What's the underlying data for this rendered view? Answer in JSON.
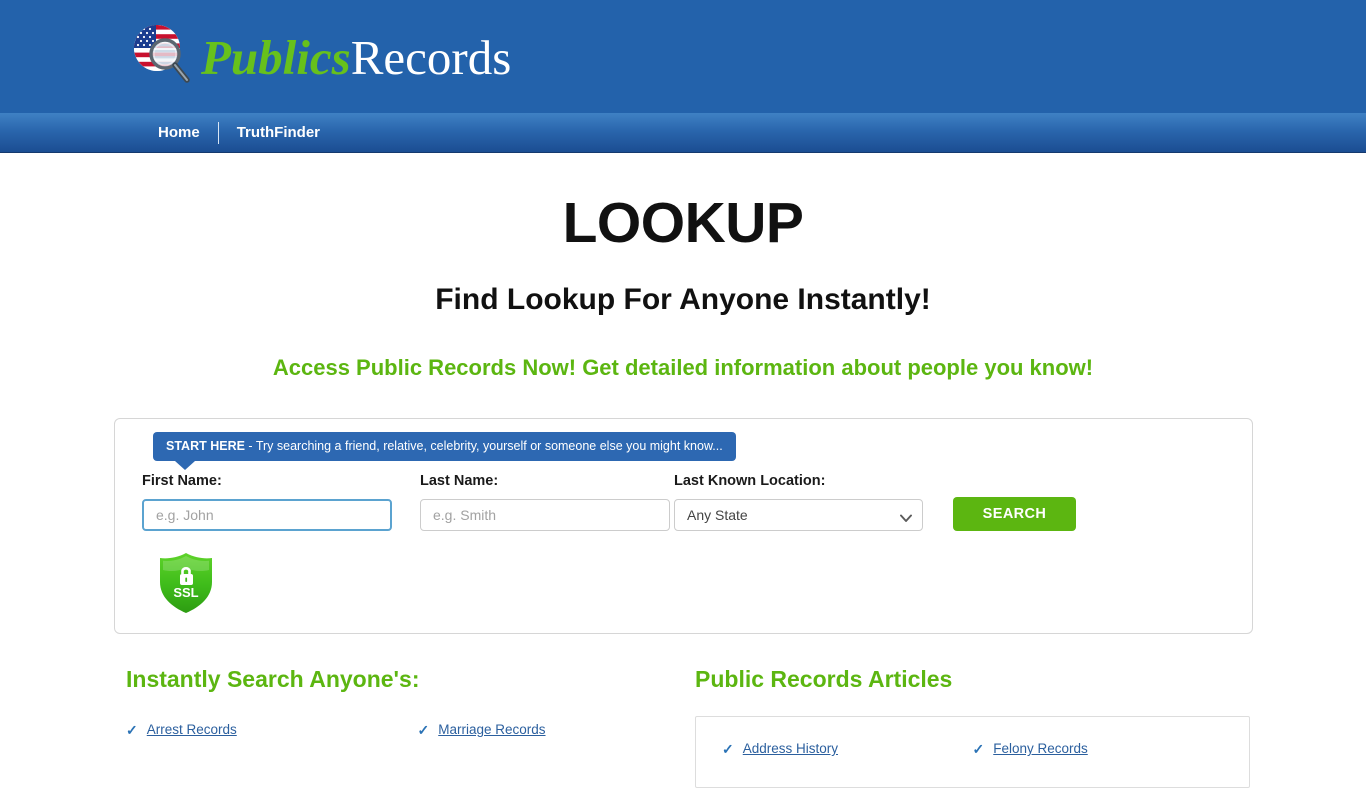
{
  "header": {
    "logo": {
      "icon": "magnifier-usflag-icon",
      "text_primary": "Publics",
      "text_secondary": "Records"
    },
    "brand_blue": "#2362ab"
  },
  "nav": {
    "items": [
      {
        "label": "Home",
        "name": "nav-item-home"
      },
      {
        "label": "TruthFinder",
        "name": "nav-item-truthfinder"
      }
    ]
  },
  "hero": {
    "title": "LOOKUP",
    "subtitle": "Find Lookup For Anyone Instantly!",
    "tagline": "Access Public Records Now! Get detailed information about people you know!",
    "tagline_color": "#5cb611"
  },
  "search": {
    "callout_bold": "START HERE",
    "callout_rest": " - Try searching a friend, relative, celebrity, yourself or someone else you might know...",
    "first_name": {
      "label": "First Name:",
      "placeholder": "e.g. John",
      "value": ""
    },
    "last_name": {
      "label": "Last Name:",
      "placeholder": "e.g. Smith",
      "value": ""
    },
    "location": {
      "label": "Last Known Location:",
      "selected": "Any State",
      "options": [
        "Any State"
      ]
    },
    "submit_label": "SEARCH",
    "submit_color": "#5cb611",
    "ssl_badge_text": "SSL"
  },
  "left_column": {
    "heading": "Instantly Search Anyone's:",
    "links": [
      {
        "label": "Arrest Records"
      },
      {
        "label": "Marriage Records"
      }
    ]
  },
  "right_column": {
    "heading": "Public Records Articles",
    "links": [
      {
        "label": "Address History"
      },
      {
        "label": "Felony Records"
      }
    ]
  }
}
